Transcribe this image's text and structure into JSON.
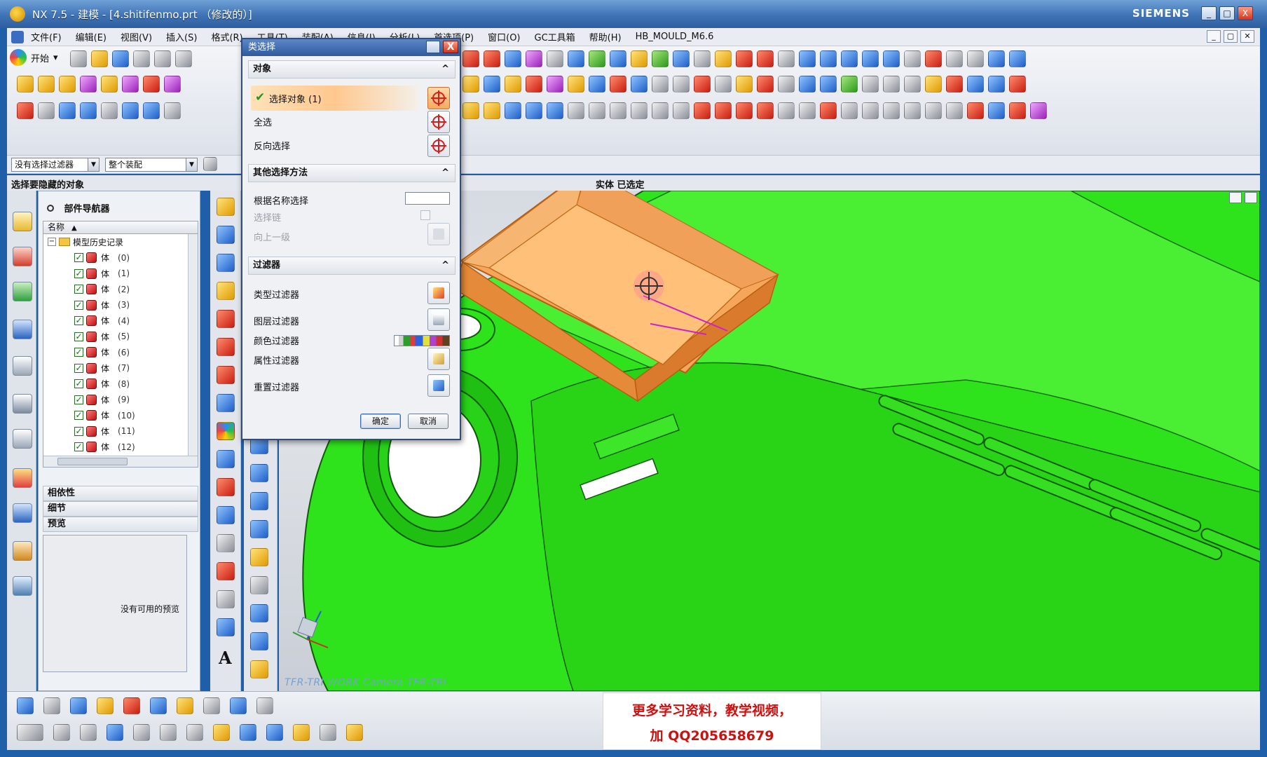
{
  "window": {
    "title": "NX 7.5 - 建模 - [4.shitifenmo.prt （修改的）]",
    "brand": "SIEMENS",
    "controls": [
      "_",
      "□",
      "X"
    ]
  },
  "menubar": {
    "items": [
      "文件(F)",
      "编辑(E)",
      "视图(V)",
      "插入(S)",
      "格式(R)",
      "工具(T)",
      "装配(A)",
      "信息(I)",
      "分析(L)",
      "首选项(P)",
      "窗口(O)",
      "GC工具箱",
      "帮助(H)",
      "HB_MOULD_M6.6"
    ]
  },
  "toolbar": {
    "start_label": "开始",
    "start_suffix": "▾"
  },
  "filterbar": {
    "type_filter": "没有选择过滤器",
    "scope_filter": "整个装配"
  },
  "cue": {
    "prompt": "选择要隐藏的对象",
    "status": "实体 已选定"
  },
  "navigator": {
    "title": "部件导航器",
    "column_name": "名称",
    "sort_glyph": "▲",
    "root_label": "模型历史记录",
    "rows": [
      {
        "label": "体",
        "index": "(0)"
      },
      {
        "label": "体",
        "index": "(1)"
      },
      {
        "label": "体",
        "index": "(2)"
      },
      {
        "label": "体",
        "index": "(3)"
      },
      {
        "label": "体",
        "index": "(4)"
      },
      {
        "label": "体",
        "index": "(5)"
      },
      {
        "label": "体",
        "index": "(6)"
      },
      {
        "label": "体",
        "index": "(7)"
      },
      {
        "label": "体",
        "index": "(8)"
      },
      {
        "label": "体",
        "index": "(9)"
      },
      {
        "label": "体",
        "index": "(10)"
      },
      {
        "label": "体",
        "index": "(11)"
      },
      {
        "label": "体",
        "index": "(12)"
      }
    ],
    "sections": {
      "dependencies": "相依性",
      "details": "细节",
      "preview": "预览"
    },
    "preview_message": "没有可用的预览"
  },
  "dialog": {
    "title": "类选择",
    "close_glyph": "X",
    "group_object": "对象",
    "select_object": "选择对象 (1)",
    "select_all": "全选",
    "invert_selection": "反向选择",
    "group_other": "其他选择方法",
    "select_by_name": "根据名称选择",
    "select_chain": "选择链",
    "up_one_level": "向上一级",
    "group_filter": "过滤器",
    "type_filter": "类型过滤器",
    "layer_filter": "图层过滤器",
    "color_filter": "颜色过滤器",
    "attribute_filter": "属性过滤器",
    "reset_filter": "重置过滤器",
    "ok": "确定",
    "cancel": "取消",
    "collapse_glyph": "^"
  },
  "graphics": {
    "camera_label": "TFR-TRI WORK Camera TFR-TRI",
    "model_color": "#2ee31c",
    "selected_color": "#f5a65b"
  },
  "watermark": {
    "line1": "更多学习资料，教学视频，",
    "line2": "加 QQ205658679"
  },
  "colors": {
    "titlebar": "#3f73b6",
    "accent_red": "#cc1111",
    "highlight": "#ffc88e"
  }
}
